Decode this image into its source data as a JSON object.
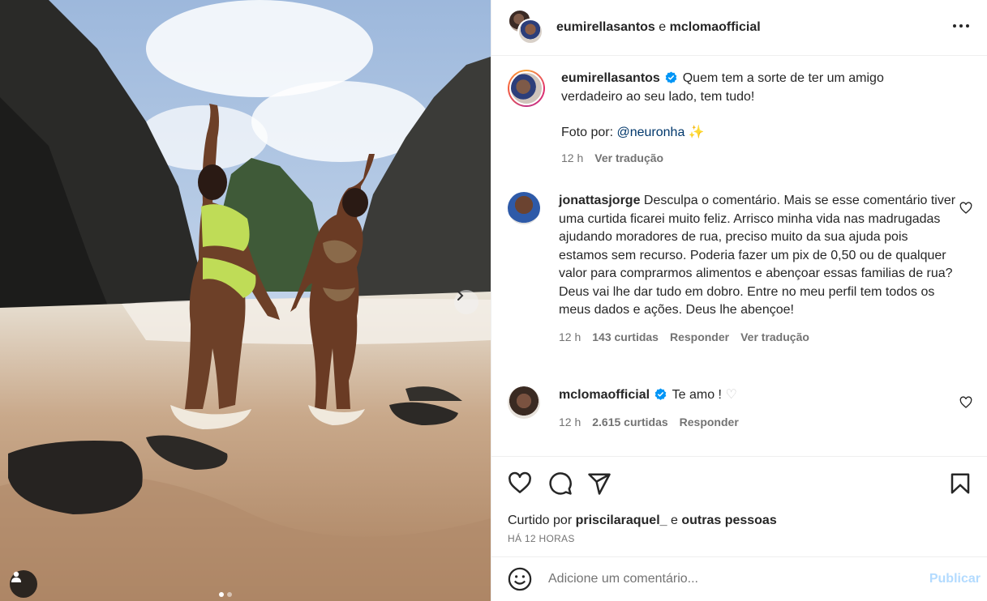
{
  "header": {
    "user1": "eumirellasantos",
    "separator": " e ",
    "user2": "mclomaofficial"
  },
  "caption": {
    "username": "eumirellasantos",
    "text": "Quem tem a sorte de ter um amigo verdadeiro ao seu lado, tem tudo!",
    "photo_credit_prefix": "Foto por: ",
    "photo_credit_handle": "@neuronha",
    "sparkle": "✨",
    "time": "12 h",
    "translate": "Ver tradução"
  },
  "comments": [
    {
      "username": "jonattasjorge",
      "text": "Desculpa o comentário. Mais se esse comentário tiver uma curtida ficarei muito feliz. Arrisco minha vida nas madrugadas ajudando moradores de rua, preciso muito da sua ajuda pois estamos sem recurso. Poderia fazer um pix de 0,50 ou de qualquer valor para comprarmos alimentos e abençoar essas familias de rua? Deus vai lhe dar tudo em dobro. Entre no meu perfil tem todos os meus dados e ações. Deus lhe abençoe!",
      "time": "12 h",
      "likes": "143 curtidas",
      "reply": "Responder",
      "translate": "Ver tradução"
    },
    {
      "username": "mclomaofficial",
      "text": "Te amo ! ",
      "emoji": "♡",
      "time": "12 h",
      "likes": "2.615 curtidas",
      "reply": "Responder"
    }
  ],
  "likes": {
    "prefix": "Curtido por ",
    "user": "priscilaraquel_",
    "middle": " e ",
    "others": "outras pessoas"
  },
  "posted_ago": "HÁ 12 HORAS",
  "add_comment": {
    "placeholder": "Adicione um comentário...",
    "publish": "Publicar"
  },
  "colors": {
    "verified": "#0095f6",
    "publish_disabled": "#b3dbff",
    "link": "#00376b"
  }
}
